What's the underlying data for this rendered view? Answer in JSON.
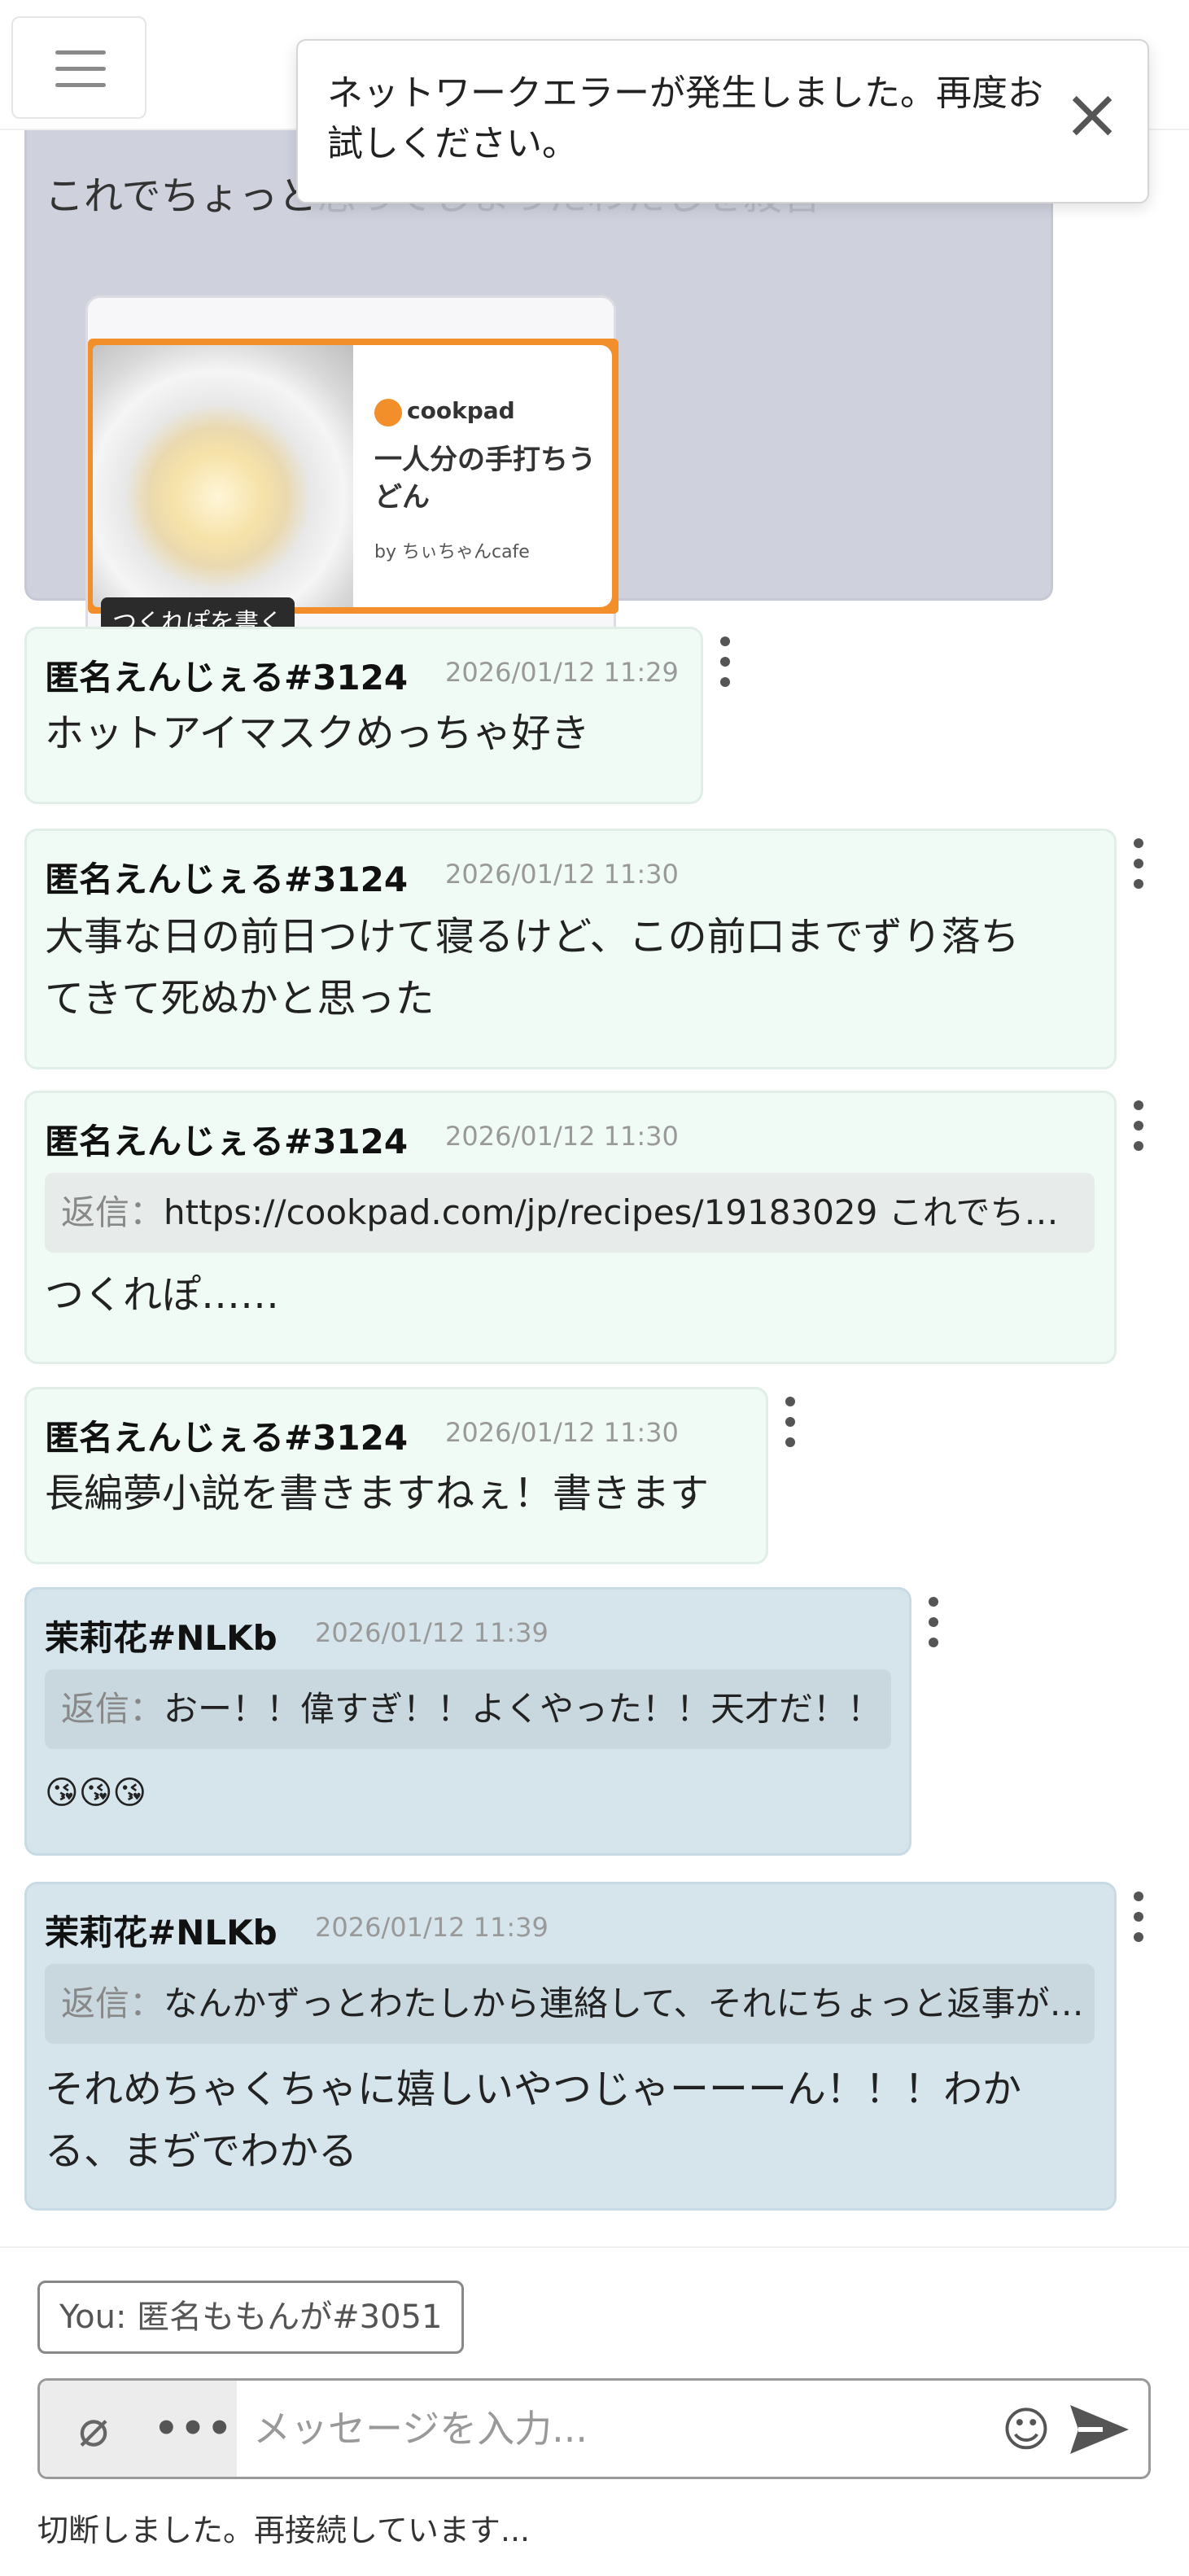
{
  "toast": {
    "message": "ネットワークエラーが発生しました。再度お試しください。"
  },
  "first_message": {
    "visible_text": "これでちょっと",
    "visible_text_ghost": "思ってしまったわたしを殺害",
    "link_card": {
      "brand": "cookpad",
      "title": "一人分の手打ちうどん",
      "by": "by ちぃちゃんcafe",
      "overlay_button": "つくれぽを書く"
    }
  },
  "messages": [
    {
      "author": "匿名えんじぇる#3124",
      "timestamp": "2026/01/12 11:29",
      "text": "ホットアイマスクめっちゃ好き"
    },
    {
      "author": "匿名えんじぇる#3124",
      "timestamp": "2026/01/12 11:30",
      "text_line1": "大事な日の前日つけて寝るけど、この前口までずり落ち",
      "text_line2": "てきて死ぬかと思った"
    },
    {
      "author": "匿名えんじぇる#3124",
      "timestamp": "2026/01/12 11:30",
      "reply_label": "返信：",
      "reply_text": "https://cookpad.com/jp/recipes/19183029 これでち…",
      "text": "つくれぽ……"
    },
    {
      "author": "匿名えんじぇる#3124",
      "timestamp": "2026/01/12 11:30",
      "text": "長編夢小説を書きますねぇ！書きます"
    },
    {
      "author": "茉莉花#NLKb",
      "timestamp": "2026/01/12 11:39",
      "reply_label": "返信：",
      "reply_text": "おー！！偉すぎ！！よくやった！！天才だ！！",
      "text": "😘😘😘"
    },
    {
      "author": "茉莉花#NLKb",
      "timestamp": "2026/01/12 11:39",
      "reply_label": "返信：",
      "reply_text": "なんかずっとわたしから連絡して、それにちょっと返事が…",
      "text_line1": "それめちゃくちゃに嬉しいやつじゃーーーん！！！わか",
      "text_line2": "る、まぢでわかる"
    }
  ],
  "composer": {
    "identity": "You: 匿名ももんが#3051",
    "placeholder": "メッセージを入力...",
    "status": "切断しました。再接続しています..."
  },
  "colors": {
    "bubble_green": "#f0fbf6",
    "bubble_blue": "#d6e5ec",
    "bubble_gray": "#cfd2dd",
    "cookpad_orange": "#f28f2b"
  }
}
